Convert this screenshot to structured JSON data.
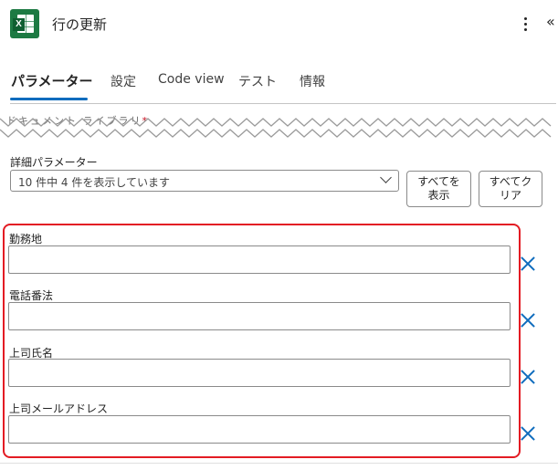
{
  "header": {
    "app_icon": "excel-icon",
    "app_icon_letter": "X",
    "title": "行の更新",
    "more_icon": "more-vertical-icon",
    "collapse_icon": "double-chevron-icon",
    "collapse_glyph": "«"
  },
  "tabs": [
    {
      "label": "パラメーター",
      "active": true
    },
    {
      "label": "設定",
      "active": false
    },
    {
      "label": "Code view",
      "active": false
    },
    {
      "label": "テスト",
      "active": false
    },
    {
      "label": "情報",
      "active": false
    }
  ],
  "clipped_field": {
    "label": "ドキュメント ライブラリ",
    "required_marker": "*"
  },
  "advanced": {
    "label": "詳細パラメーター",
    "dropdown_value": "10 件中 4 件を表示しています",
    "show_all_line1": "すべてを",
    "show_all_line2": "表示",
    "clear_all_line1": "すべてク",
    "clear_all_line2": "リア"
  },
  "fields": [
    {
      "label": "勤務地",
      "value": ""
    },
    {
      "label": "電話番法",
      "value": ""
    },
    {
      "label": "上司氏名",
      "value": ""
    },
    {
      "label": "上司メールアドレス",
      "value": ""
    }
  ],
  "colors": {
    "accent": "#0f6cbd",
    "excel_green": "#1d7a43",
    "highlight_red": "#e31b23"
  }
}
